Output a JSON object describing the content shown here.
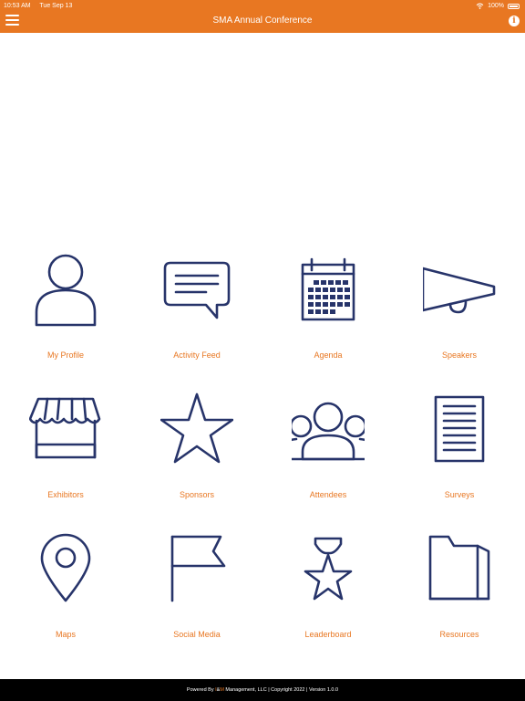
{
  "status_bar": {
    "time": "10:53 AM",
    "date": "Tue Sep 13",
    "battery": "100%"
  },
  "header": {
    "title": "SMA Annual Conference",
    "menu_icon": "hamburger-icon",
    "info_icon": "info-icon",
    "info_glyph": "i",
    "accent": "#E87722"
  },
  "tiles": [
    {
      "label": "My Profile",
      "icon": "person-icon"
    },
    {
      "label": "Activity Feed",
      "icon": "chat-bubble-icon"
    },
    {
      "label": "Agenda",
      "icon": "calendar-icon"
    },
    {
      "label": "Speakers",
      "icon": "megaphone-icon"
    },
    {
      "label": "Exhibitors",
      "icon": "storefront-icon"
    },
    {
      "label": "Sponsors",
      "icon": "star-icon"
    },
    {
      "label": "Attendees",
      "icon": "group-icon"
    },
    {
      "label": "Surveys",
      "icon": "document-icon"
    },
    {
      "label": "Maps",
      "icon": "map-pin-icon"
    },
    {
      "label": "Social Media",
      "icon": "flag-icon"
    },
    {
      "label": "Leaderboard",
      "icon": "medal-icon"
    },
    {
      "label": "Resources",
      "icon": "folder-icon"
    }
  ],
  "footer": {
    "prefix": "Powered By ",
    "brand_a": "I",
    "amp": "&",
    "brand_m": "M",
    "rest": " Management, LLC | Copyright 2022 | Version 1.0.0"
  },
  "colors": {
    "header_bg": "#E87722",
    "icon": "#27346A",
    "label": "#E87722",
    "footer_bg": "#000000"
  }
}
